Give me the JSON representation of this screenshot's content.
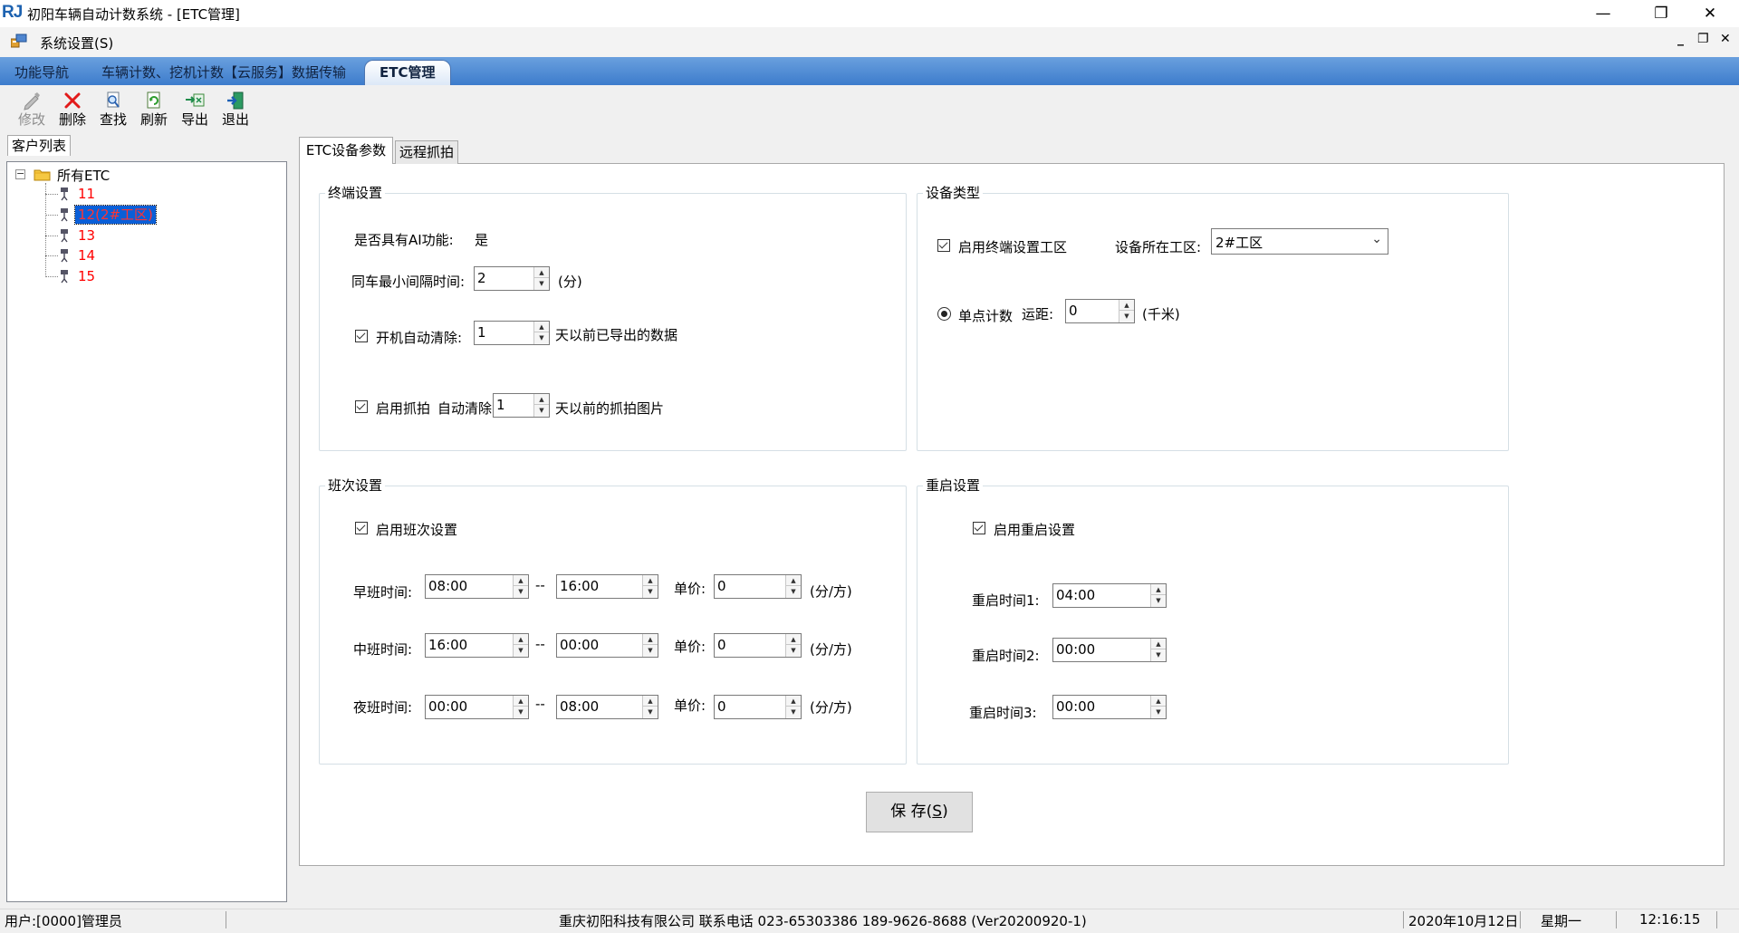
{
  "window": {
    "logo_text": "RJ",
    "title": "初阳车辆自动计数系统 - [ETC管理]",
    "minimize_glyph": "—",
    "restore_glyph": "❐",
    "close_glyph": "✕"
  },
  "menu": {
    "settings_label": "系统设置(S)",
    "mdi_min": "_",
    "mdi_restore": "❐",
    "mdi_close": "✕"
  },
  "top_tabs": [
    {
      "label": "功能导航"
    },
    {
      "label": "车辆计数、挖机计数【云服务】数据传输"
    },
    {
      "label": "ETC管理"
    }
  ],
  "toolbar": [
    {
      "label": "修改",
      "icon": "edit-icon",
      "enabled": false
    },
    {
      "label": "删除",
      "icon": "delete-icon",
      "enabled": true
    },
    {
      "label": "查找",
      "icon": "search-icon",
      "enabled": true
    },
    {
      "label": "刷新",
      "icon": "refresh-icon",
      "enabled": true
    },
    {
      "label": "导出",
      "icon": "export-icon",
      "enabled": true
    },
    {
      "label": "退出",
      "icon": "exit-icon",
      "enabled": true
    }
  ],
  "left_panel": {
    "tab_label": "客户列表",
    "tree": {
      "root_label": "所有ETC",
      "expander": "−",
      "children": [
        {
          "label": "11",
          "selected": false
        },
        {
          "label": "12(2#工区)",
          "selected": true
        },
        {
          "label": "13",
          "selected": false
        },
        {
          "label": "14",
          "selected": false
        },
        {
          "label": "15",
          "selected": false
        }
      ]
    }
  },
  "inner_tabs": [
    {
      "label": "ETC设备参数",
      "active": true
    },
    {
      "label": "远程抓拍",
      "active": false
    }
  ],
  "terminal_settings": {
    "title": "终端设置",
    "ai_label": "是否具有AI功能:",
    "ai_value": "是",
    "min_interval_label": "同车最小间隔时间:",
    "min_interval_value": "2",
    "min_interval_unit": "(分)",
    "auto_clear_checked": true,
    "auto_clear_label": "开机自动清除:",
    "auto_clear_value": "1",
    "auto_clear_suffix": "天以前已导出的数据",
    "capture_checked": true,
    "capture_label": "启用抓拍",
    "capture_clear_label": "自动清除",
    "capture_clear_value": "1",
    "capture_clear_suffix": "天以前的抓拍图片"
  },
  "device_type": {
    "title": "设备类型",
    "enable_terminal_area_checked": true,
    "enable_terminal_area_label": "启用终端设置工区",
    "area_label": "设备所在工区:",
    "area_value": "2#工区",
    "single_count_selected": true,
    "single_count_label": "单点计数",
    "distance_label": "运距:",
    "distance_value": "0",
    "distance_unit": "(千米)"
  },
  "shift_settings": {
    "title": "班次设置",
    "enable_checked": true,
    "enable_label": "启用班次设置",
    "separator": "--",
    "price_label": "单价:",
    "price_unit": "(分/方)",
    "shifts": [
      {
        "label": "早班时间:",
        "start": "08:00",
        "end": "16:00",
        "price": "0"
      },
      {
        "label": "中班时间:",
        "start": "16:00",
        "end": "00:00",
        "price": "0"
      },
      {
        "label": "夜班时间:",
        "start": "00:00",
        "end": "08:00",
        "price": "0"
      }
    ]
  },
  "restart_settings": {
    "title": "重启设置",
    "enable_checked": true,
    "enable_label": "启用重启设置",
    "times": [
      {
        "label": "重启时间1:",
        "value": "04:00"
      },
      {
        "label": "重启时间2:",
        "value": "00:00"
      },
      {
        "label": "重启时间3:",
        "value": "00:00"
      }
    ]
  },
  "save_button": {
    "label_main": "保 存(",
    "accel": "S",
    "label_end": ")"
  },
  "status_bar": {
    "user": "用户:[0000]管理员",
    "company": "重庆初阳科技有限公司 联系电话 023-65303386 189-9626-8688  (Ver20200920-1)",
    "date": "2020年10月12日",
    "weekday": "星期一",
    "time": "12:16:15"
  }
}
